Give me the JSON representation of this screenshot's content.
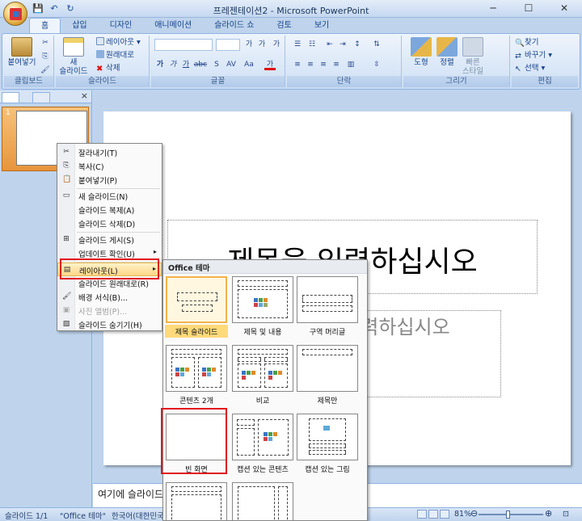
{
  "window": {
    "title": "프레젠테이션2 - Microsoft PowerPoint",
    "controls": {
      "minimize": "─",
      "maximize": "☐",
      "close": "✕"
    }
  },
  "quick_access": {
    "save": "💾",
    "undo": "↶",
    "redo": "↻"
  },
  "tabs": [
    "홈",
    "삽입",
    "디자인",
    "애니메이션",
    "슬라이드 쇼",
    "검토",
    "보기"
  ],
  "active_tab": "홈",
  "ribbon": {
    "clipboard": {
      "label": "클립보드",
      "paste": "붙여넣기"
    },
    "slides": {
      "label": "슬라이드",
      "new_slide": "새",
      "new_slide_2": "슬라이드",
      "layout": "레이아웃",
      "reset": "원래대로",
      "delete": "삭제"
    },
    "font": {
      "label": "글꼴",
      "grow": "가",
      "shrink": "가",
      "clear": "가",
      "bold": "가",
      "italic": "가",
      "underline": "가",
      "strike": "abc",
      "shadow": "S",
      "spacing": "AV",
      "case": "Aa",
      "color": "가"
    },
    "paragraph": {
      "label": "단락"
    },
    "drawing": {
      "label": "그리기",
      "shapes": "도형",
      "arrange": "정렬",
      "quick_styles": "빠른",
      "quick_styles_2": "스타일"
    },
    "editing": {
      "label": "편집",
      "find": "찾기",
      "replace": "바꾸기",
      "select": "선택"
    }
  },
  "slide": {
    "number": "1",
    "title_placeholder": "제목을 입력하십시오",
    "subtitle_placeholder": "부제목을 입력하십시오"
  },
  "notes_placeholder": "여기에 슬라이드 노트를 입력하십시오",
  "status": {
    "slide": "슬라이드 1/1",
    "theme": "\"Office 테마\"",
    "language": "한국어(대한민국)",
    "zoom": "81%"
  },
  "context_menu": {
    "items": [
      {
        "label": "잘라내기(T)",
        "icon": "✂"
      },
      {
        "label": "복사(C)",
        "icon": "⎘"
      },
      {
        "label": "붙여넣기(P)",
        "icon": "📋"
      },
      {
        "label": "새 슬라이드(N)",
        "icon": "▭"
      },
      {
        "label": "슬라이드 복제(A)",
        "icon": ""
      },
      {
        "label": "슬라이드 삭제(D)",
        "icon": ""
      },
      {
        "label": "슬라이드 게시(S)",
        "icon": "⊞"
      },
      {
        "label": "업데이트 확인(U)",
        "icon": ""
      },
      {
        "label": "레이아웃(L)",
        "icon": "▤"
      },
      {
        "label": "슬라이드 원래대로(R)",
        "icon": ""
      },
      {
        "label": "배경 서식(B)...",
        "icon": "🖌"
      },
      {
        "label": "사진 앨범(P)...",
        "icon": "▣"
      },
      {
        "label": "슬라이드 숨기기(H)",
        "icon": "▧"
      }
    ]
  },
  "layout_gallery": {
    "header": "Office 테마",
    "layouts": [
      "제목 슬라이드",
      "제목 및 내용",
      "구역 머리글",
      "콘텐츠 2개",
      "비교",
      "제목만",
      "빈 화면",
      "캡션 있는 콘텐츠",
      "캡션 있는 그림",
      "",
      ""
    ]
  },
  "colors": {
    "ribbon_bg": "#d8e6f7",
    "highlight": "#ffd787",
    "annotation_red": "#e1141c"
  }
}
